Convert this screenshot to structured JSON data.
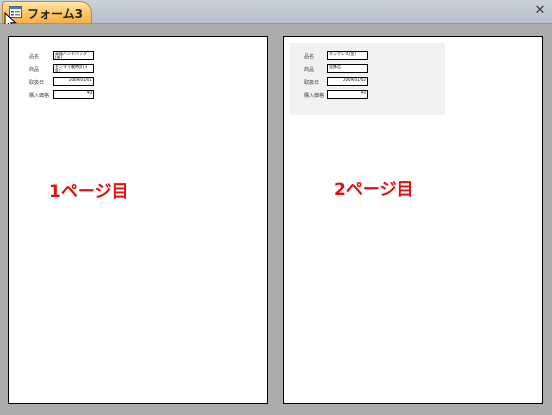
{
  "tab": {
    "title": "フォーム3",
    "icon": "form-icon"
  },
  "close_icon": "close-icon",
  "accent_colors": {
    "tab": "#fbc564",
    "caption": "#e01010",
    "background": "#ababab"
  },
  "pages": [
    {
      "caption": "1ページ目",
      "fields": [
        {
          "label": "品名",
          "value": "高級ハンドバッグ(茶)"
        },
        {
          "label": "商品",
          "value": "ゼンマイ腕時計(3針)"
        },
        {
          "label": "取扱日",
          "value": "2009/01/01"
        },
        {
          "label": "購入価格",
          "value": "¥0"
        }
      ]
    },
    {
      "caption": "2ページ目",
      "fields": [
        {
          "label": "品名",
          "value": "ネックレス(金)"
        },
        {
          "label": "商品",
          "value": "宝飾品"
        },
        {
          "label": "取扱日",
          "value": "2009/01/02"
        },
        {
          "label": "購入価格",
          "value": "¥0"
        }
      ]
    }
  ]
}
